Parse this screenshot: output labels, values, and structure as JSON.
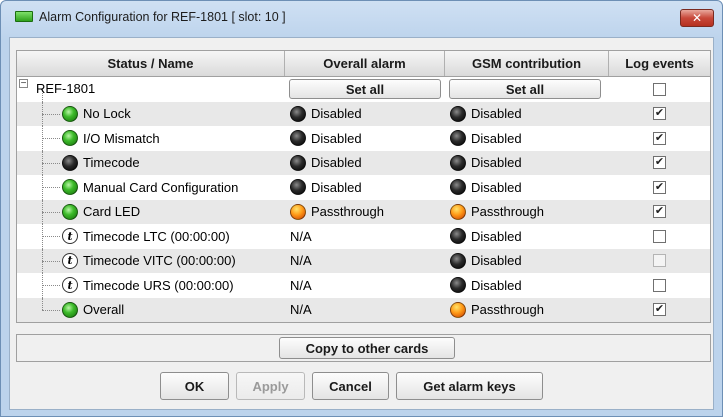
{
  "window": {
    "title": "Alarm Configuration for REF-1801 [ slot: 10 ]",
    "close_label": "✕"
  },
  "columns": [
    "Status / Name",
    "Overall alarm",
    "GSM contribution",
    "Log events"
  ],
  "root": {
    "expander": "−",
    "name": "REF-1801",
    "overall_button": "Set all",
    "gsm_button": "Set all",
    "log": false
  },
  "rows": [
    {
      "icon": "green",
      "name": "No Lock",
      "overall_icon": "black",
      "overall": "Disabled",
      "gsm_icon": "black",
      "gsm": "Disabled",
      "log": true
    },
    {
      "icon": "green",
      "name": "I/O Mismatch",
      "overall_icon": "black",
      "overall": "Disabled",
      "gsm_icon": "black",
      "gsm": "Disabled",
      "log": true
    },
    {
      "icon": "black",
      "name": "Timecode",
      "overall_icon": "black",
      "overall": "Disabled",
      "gsm_icon": "black",
      "gsm": "Disabled",
      "log": true
    },
    {
      "icon": "green",
      "name": "Manual Card Configuration",
      "overall_icon": "black",
      "overall": "Disabled",
      "gsm_icon": "black",
      "gsm": "Disabled",
      "log": true
    },
    {
      "icon": "green",
      "name": "Card LED",
      "overall_icon": "orange",
      "overall": "Passthrough",
      "gsm_icon": "orange",
      "gsm": "Passthrough",
      "log": true
    },
    {
      "icon": "info",
      "name": "Timecode LTC (00:00:00)",
      "overall_icon": "",
      "overall": "N/A",
      "gsm_icon": "black",
      "gsm": "Disabled",
      "log": false
    },
    {
      "icon": "info",
      "name": "Timecode VITC (00:00:00)",
      "overall_icon": "",
      "overall": "N/A",
      "gsm_icon": "black",
      "gsm": "Disabled",
      "log": false,
      "log_disabled": true
    },
    {
      "icon": "info",
      "name": "Timecode URS (00:00:00)",
      "overall_icon": "",
      "overall": "N/A",
      "gsm_icon": "black",
      "gsm": "Disabled",
      "log": false
    },
    {
      "icon": "green",
      "name": "Overall",
      "overall_icon": "",
      "overall": "N/A",
      "gsm_icon": "orange",
      "gsm": "Passthrough",
      "log": true
    }
  ],
  "copy_button": "Copy to other cards",
  "footer": {
    "ok": "OK",
    "apply": "Apply",
    "cancel": "Cancel",
    "get_keys": "Get alarm keys"
  },
  "icons": {
    "info_glyph": "t",
    "check_glyph": "✔"
  },
  "colors": {
    "led_green": "#3dbb2a",
    "led_black": "#1a1a1a",
    "led_orange": "#ff9a17",
    "close_button": "#c8483a"
  }
}
